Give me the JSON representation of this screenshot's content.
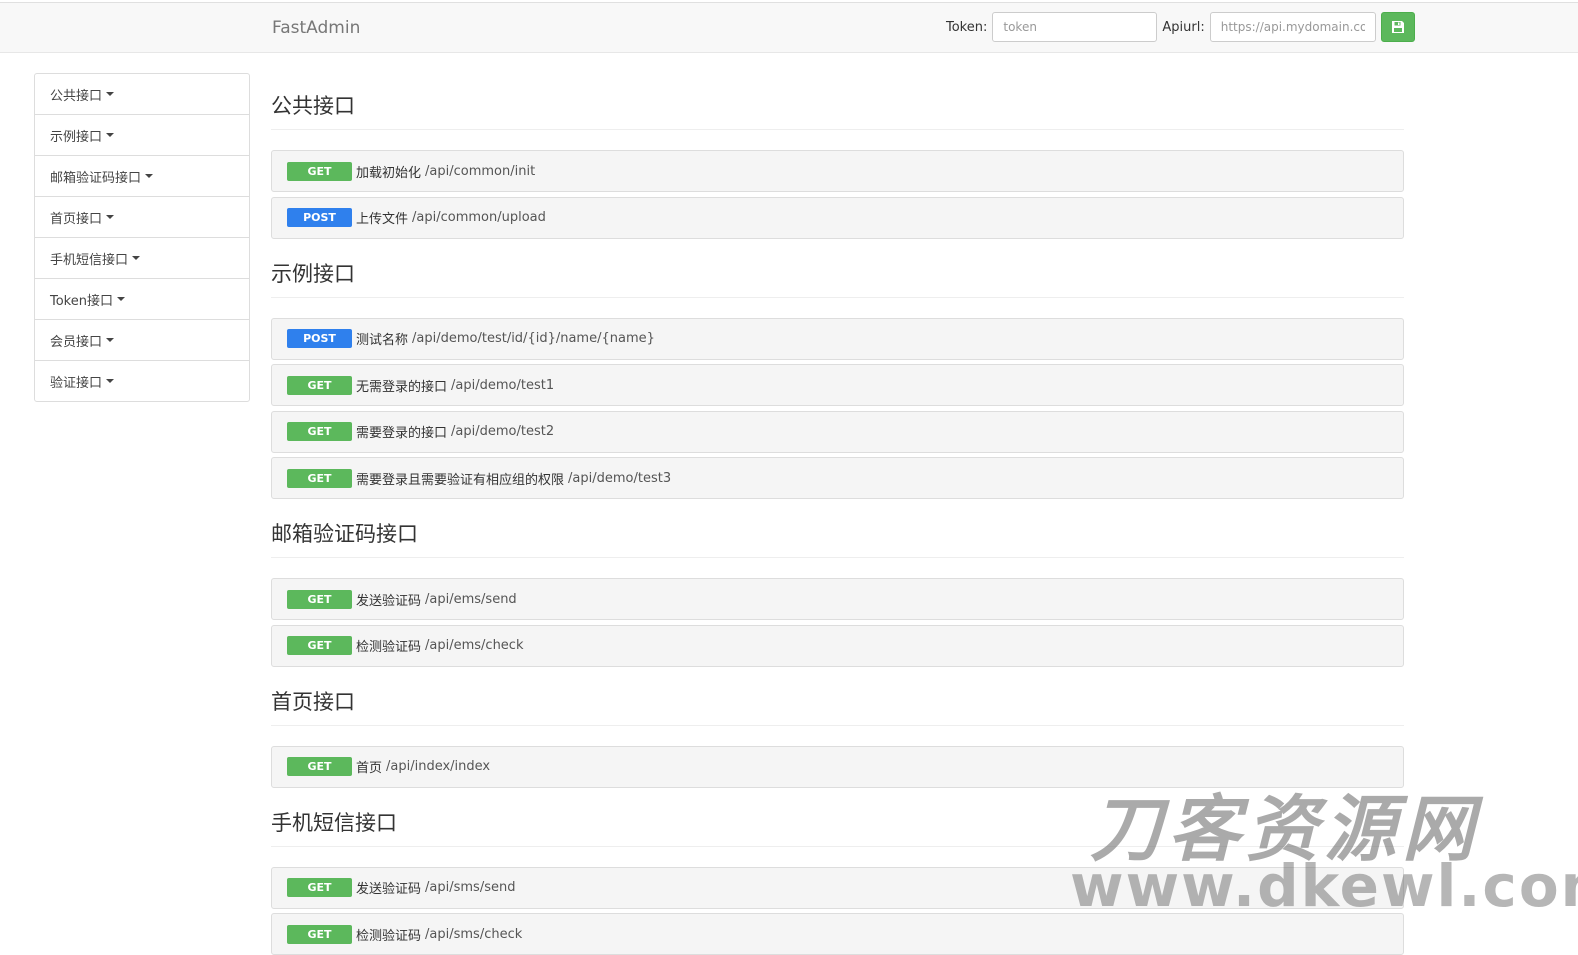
{
  "navbar": {
    "brand": "FastAdmin",
    "token_label": "Token:",
    "token_placeholder": "token",
    "apiurl_label": "Apiurl:",
    "apiurl_placeholder": "https://api.mydomain.com",
    "save_icon": "floppy-disk-icon"
  },
  "sidebar": {
    "items": [
      {
        "label": "公共接口"
      },
      {
        "label": "示例接口"
      },
      {
        "label": "邮箱验证码接口"
      },
      {
        "label": "首页接口"
      },
      {
        "label": "手机短信接口"
      },
      {
        "label": "Token接口"
      },
      {
        "label": "会员接口"
      },
      {
        "label": "验证接口"
      }
    ]
  },
  "sections": [
    {
      "title": "公共接口",
      "endpoints": [
        {
          "method": "GET",
          "name": "加载初始化",
          "path": "/api/common/init"
        },
        {
          "method": "POST",
          "name": "上传文件",
          "path": "/api/common/upload"
        }
      ]
    },
    {
      "title": "示例接口",
      "endpoints": [
        {
          "method": "POST",
          "name": "测试名称",
          "path": "/api/demo/test/id/{id}/name/{name}"
        },
        {
          "method": "GET",
          "name": "无需登录的接口",
          "path": "/api/demo/test1"
        },
        {
          "method": "GET",
          "name": "需要登录的接口",
          "path": "/api/demo/test2"
        },
        {
          "method": "GET",
          "name": "需要登录且需要验证有相应组的权限",
          "path": "/api/demo/test3"
        }
      ]
    },
    {
      "title": "邮箱验证码接口",
      "endpoints": [
        {
          "method": "GET",
          "name": "发送验证码",
          "path": "/api/ems/send"
        },
        {
          "method": "GET",
          "name": "检测验证码",
          "path": "/api/ems/check"
        }
      ]
    },
    {
      "title": "首页接口",
      "endpoints": [
        {
          "method": "GET",
          "name": "首页",
          "path": "/api/index/index"
        }
      ]
    },
    {
      "title": "手机短信接口",
      "endpoints": [
        {
          "method": "GET",
          "name": "发送验证码",
          "path": "/api/sms/send"
        },
        {
          "method": "GET",
          "name": "检测验证码",
          "path": "/api/sms/check"
        }
      ]
    }
  ],
  "watermark": {
    "title": "刀客资源网",
    "url": "www.dkewl.com"
  },
  "colors": {
    "get": "#5cb85c",
    "post": "#2f80ed",
    "save_button": "#5cb85c"
  }
}
